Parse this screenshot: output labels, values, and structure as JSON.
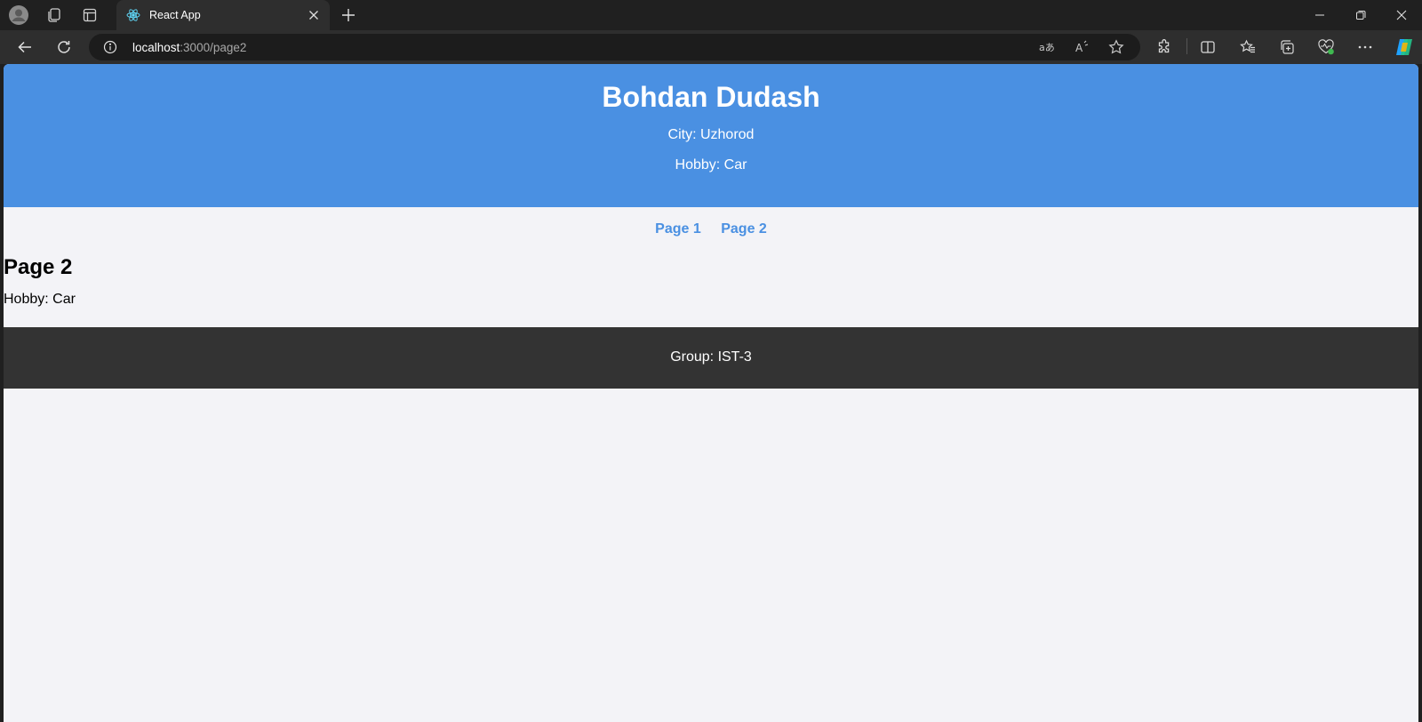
{
  "browser": {
    "tab_title": "React App",
    "url_host": "localhost",
    "url_path": ":3000/page2",
    "icons": [
      "profile-icon",
      "workspaces-icon",
      "tab-actions-icon",
      "react-favicon-icon",
      "close-tab-icon",
      "new-tab-icon",
      "minimize-icon",
      "restore-icon",
      "close-window-icon",
      "back-icon",
      "refresh-icon",
      "site-info-icon",
      "translate-icon",
      "read-aloud-icon",
      "favorite-star-icon",
      "extensions-icon",
      "split-screen-icon",
      "favorites-icon",
      "collections-icon",
      "browser-essentials-icon",
      "more-icon",
      "copilot-icon"
    ]
  },
  "header": {
    "name": "Bohdan Dudash",
    "city": "City: Uzhorod",
    "hobby": "Hobby: Car"
  },
  "nav": {
    "page1": "Page 1",
    "page2": "Page 2"
  },
  "content": {
    "title": "Page 2",
    "hobby": "Hobby: Car"
  },
  "footer": {
    "group": "Group: IST-3"
  },
  "colors": {
    "header_bg": "#4a90e2",
    "link": "#4a90e2",
    "footer_bg": "#333333",
    "page_bg": "#f3f3f7"
  }
}
